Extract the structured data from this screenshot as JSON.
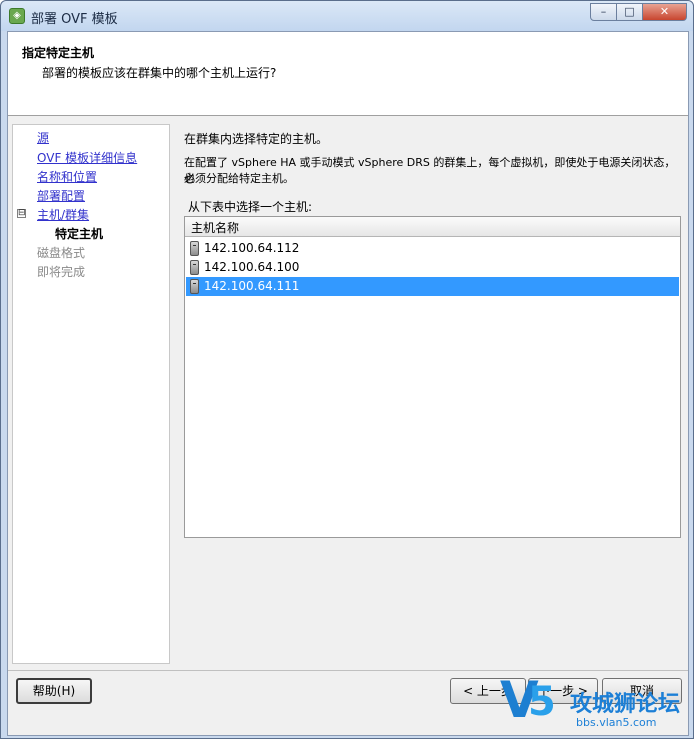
{
  "window": {
    "title": "部署 OVF 模板",
    "minimize_glyph": "–",
    "maximize_glyph": "□",
    "close_glyph": "✕"
  },
  "header": {
    "title": "指定特定主机",
    "subtitle": "部署的模板应该在群集中的哪个主机上运行?"
  },
  "sidebar": {
    "toggle_glyph": "⊟",
    "items": [
      {
        "label": "源",
        "state": "link"
      },
      {
        "label": "OVF 模板详细信息",
        "state": "link"
      },
      {
        "label": "名称和位置",
        "state": "link"
      },
      {
        "label": "部署配置",
        "state": "link"
      },
      {
        "label": "主机/群集",
        "state": "link"
      },
      {
        "label": "特定主机",
        "state": "current"
      },
      {
        "label": "磁盘格式",
        "state": "disabled"
      },
      {
        "label": "即将完成",
        "state": "disabled"
      }
    ]
  },
  "content": {
    "heading": "在群集内选择特定的主机。",
    "description_line1": "在配置了 vSphere HA 或手动模式 vSphere DRS 的群集上，每个虚拟机，即使处于电源关闭状态，也",
    "description_line2": "必须分配给特定主机。",
    "list_prompt": "从下表中选择一个主机:",
    "column_header": "主机名称",
    "hosts": [
      {
        "name": "142.100.64.112",
        "selected": false
      },
      {
        "name": "142.100.64.100",
        "selected": false
      },
      {
        "name": "142.100.64.111",
        "selected": true
      }
    ]
  },
  "buttons": {
    "help": "帮助(H)",
    "back": "< 上一步",
    "next": "下一步 >",
    "cancel": "取消"
  },
  "watermark": {
    "logo_v": "V",
    "logo_5": "5",
    "text": "攻城狮论坛",
    "url": "bbs.vlan5.com"
  },
  "colors": {
    "selection": "#3399ff",
    "link": "#3232cc"
  }
}
